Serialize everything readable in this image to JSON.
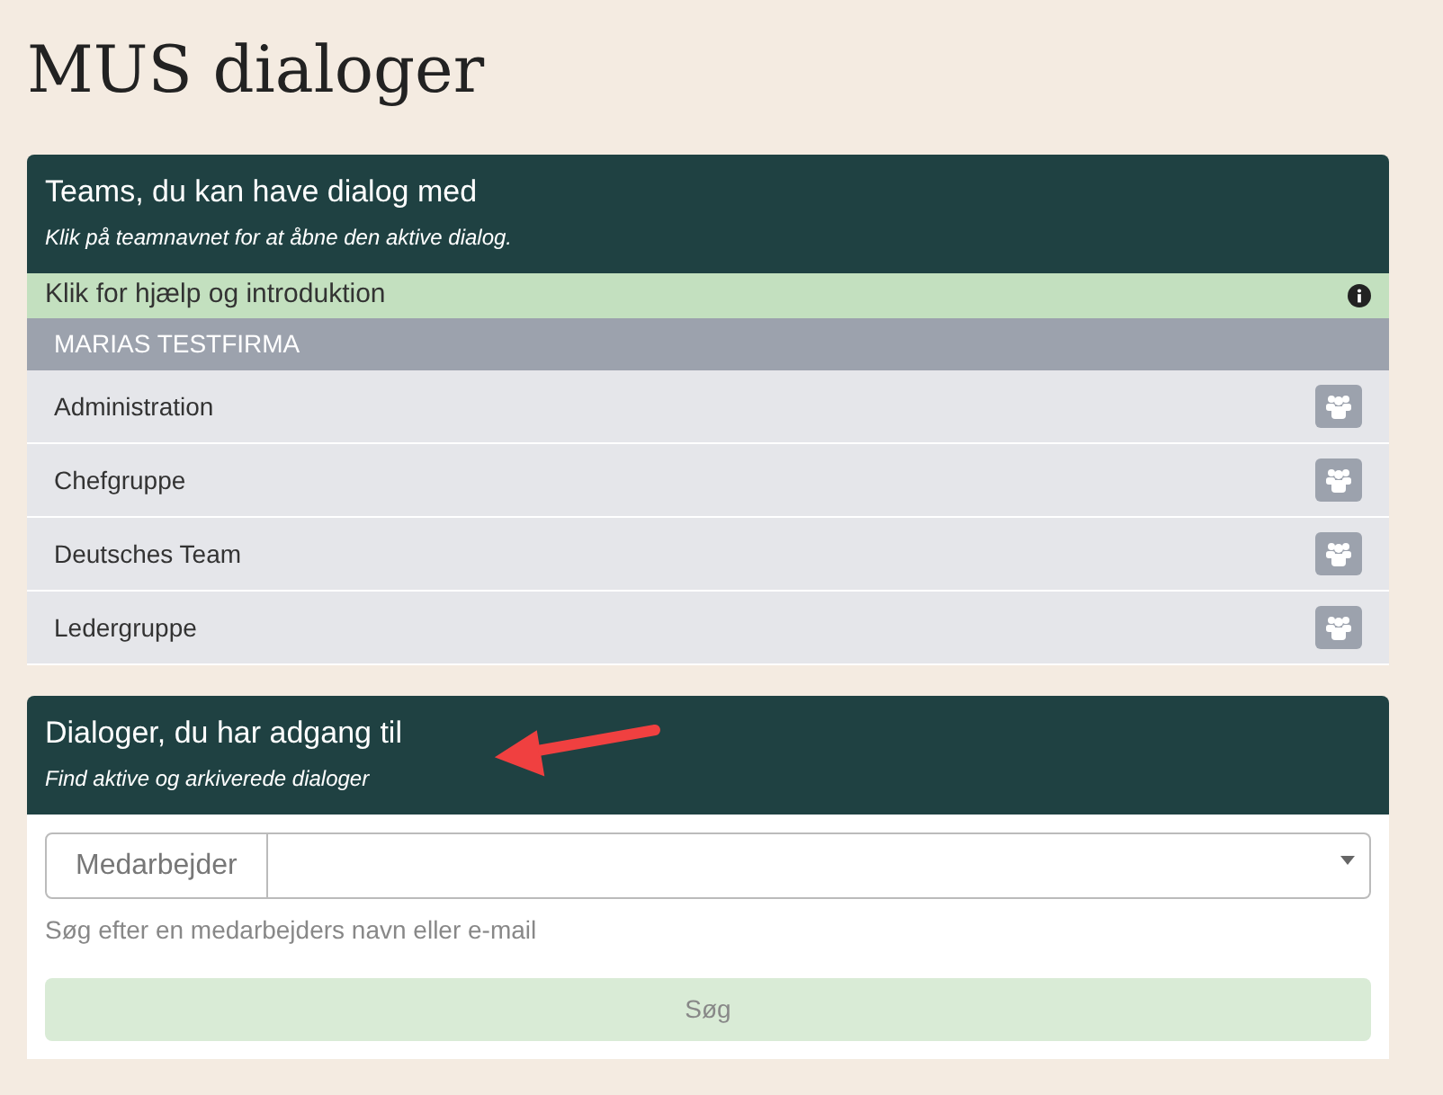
{
  "page_title": "MUS dialoger",
  "teams_panel": {
    "title": "Teams, du kan have dialog med",
    "subtitle": "Klik på teamnavnet for at åbne den aktive dialog.",
    "help": "Klik for hjælp og introduktion",
    "company": "MARIAS TESTFIRMA",
    "teams": [
      {
        "name": "Administration"
      },
      {
        "name": "Chefgruppe"
      },
      {
        "name": "Deutsches Team"
      },
      {
        "name": "Ledergruppe"
      }
    ]
  },
  "dialogs_panel": {
    "title": "Dialoger, du har adgang til",
    "subtitle": "Find aktive og arkiverede dialoger",
    "field_label": "Medarbejder",
    "hint": "Søg efter en medarbejders navn eller e-mail",
    "search_button": {
      "label": "Søg",
      "disabled": true
    }
  }
}
